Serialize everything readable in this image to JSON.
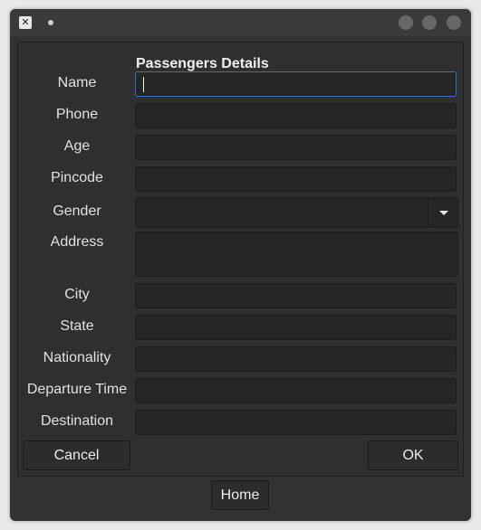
{
  "form": {
    "title": "Passengers Details",
    "fields": {
      "name": {
        "label": "Name",
        "value": ""
      },
      "phone": {
        "label": "Phone",
        "value": ""
      },
      "age": {
        "label": "Age",
        "value": ""
      },
      "pincode": {
        "label": "Pincode",
        "value": ""
      },
      "gender": {
        "label": "Gender",
        "value": ""
      },
      "address": {
        "label": "Address",
        "value": ""
      },
      "city": {
        "label": "City",
        "value": ""
      },
      "state": {
        "label": "State",
        "value": ""
      },
      "nationality": {
        "label": "Nationality",
        "value": ""
      },
      "departure_time": {
        "label": "Departure Time",
        "value": ""
      },
      "destination": {
        "label": "Destination",
        "value": ""
      }
    },
    "cancel_label": "Cancel",
    "ok_label": "OK"
  },
  "home_label": "Home",
  "colors": {
    "window_bg": "#323232",
    "field_bg": "#262626",
    "focus_border": "#3d6fb4",
    "text": "#e8e8e8"
  }
}
